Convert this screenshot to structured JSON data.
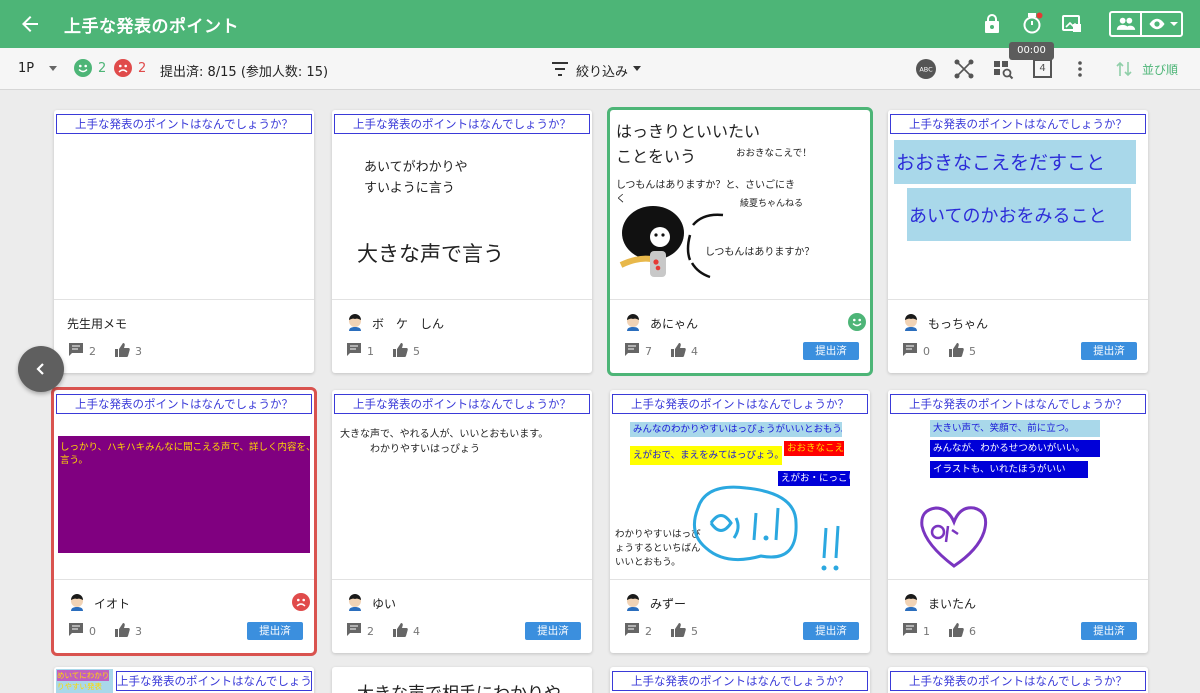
{
  "header": {
    "title": "上手な発表のポイント",
    "timer": "00:00",
    "colors": {
      "brand": "#4db577"
    },
    "icons": [
      "back-arrow-icon",
      "lock-icon",
      "timer-icon",
      "image-icon",
      "people-icon",
      "eye-icon",
      "caret-down-icon"
    ]
  },
  "toolbar": {
    "page": "1P",
    "good_count": "2",
    "bad_count": "2",
    "submitted": "提出済: 8/15 (参加人数: 15)",
    "filter": "絞り込み",
    "sort": "並び順",
    "number_box": "4"
  },
  "question": "上手な発表のポイントはなんでしょうか？",
  "cards": [
    {
      "author": "先生用メモ",
      "comments": "2",
      "likes": "3",
      "status": "",
      "content": []
    },
    {
      "author": "ボ　ケ　しん",
      "comments": "1",
      "likes": "5",
      "status": "",
      "content": [
        "あいてがわかりや",
        "すいように言う",
        "大きな声で言う"
      ]
    },
    {
      "author": "あにゃん",
      "comments": "7",
      "likes": "4",
      "status": "提出済",
      "reaction": "good",
      "content": [
        "はっきりといいたい",
        "ことをいう",
        "おおきなこえで！",
        "しつもんはありますか？と、さいごにき",
        "く",
        "綾夏ちゃんねる",
        "しつもんはありますか？"
      ]
    },
    {
      "author": "もっちゃん",
      "comments": "0",
      "likes": "5",
      "status": "提出済",
      "content": [
        "おおきなこえをだすこと",
        "あいてのかおをみること"
      ]
    },
    {
      "author": "イオト",
      "comments": "0",
      "likes": "3",
      "status": "提出済",
      "reaction": "bad",
      "content": [
        "しっかり、ハキハキみんなに聞こえる声で、詳しく内容を、",
        "言う。"
      ]
    },
    {
      "author": "ゆい",
      "comments": "2",
      "likes": "4",
      "status": "提出済",
      "content": [
        "大きな声で、やれる人が、いいとおもいます。",
        "わかりやすいはっぴょう"
      ]
    },
    {
      "author": "みずー",
      "comments": "2",
      "likes": "5",
      "status": "提出済",
      "content": [
        "みんなのわかりやすいはっぴょうがいいとおもう。",
        "おおきなこえ",
        "えがおで、まえをみてはっぴょう。",
        "えがお・にっこり",
        "わかりやすいはっぴ",
        "ょうするといちばん",
        "いいとおもう。"
      ]
    },
    {
      "author": "まいたん",
      "comments": "1",
      "likes": "6",
      "status": "提出済",
      "content": [
        "大きい声で、笑顔で、前に立つ。",
        "みんなが、わかるせつめいがいい。",
        "イラストも、いれたほうがいい"
      ]
    }
  ],
  "partial": {
    "sticker": "めいてにわかり",
    "sticker2": "りやすい発表",
    "card10_text": "大きな声で相手にわかりや"
  }
}
